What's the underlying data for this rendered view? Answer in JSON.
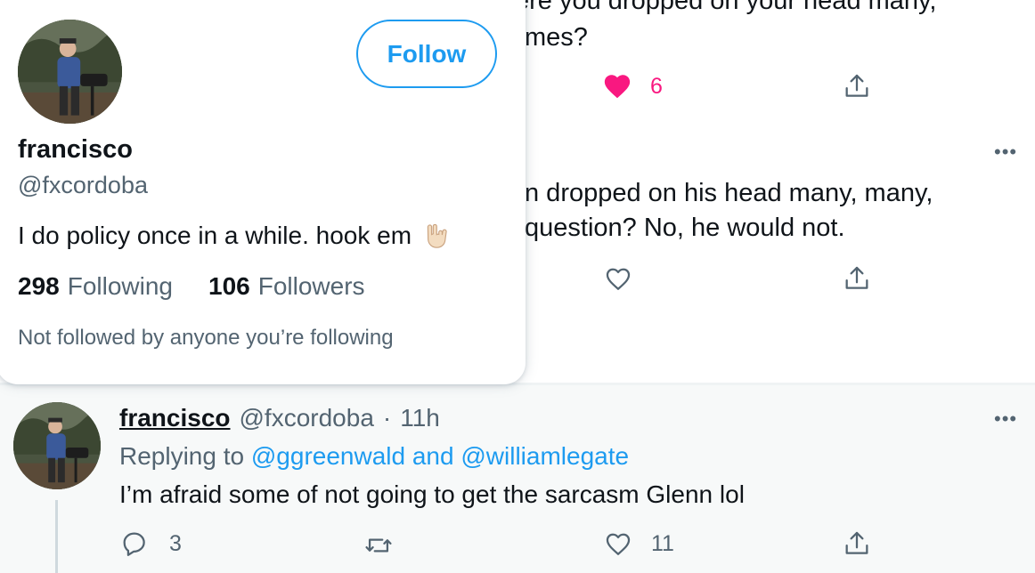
{
  "timeline": {
    "tweet1": {
      "text_line1": "ere you dropped on your head many,",
      "text_line2": "mes?",
      "like_count": "6"
    },
    "tweet2": {
      "text_line1": "n dropped on his head many, many,",
      "text_line2": "question? No, he would not."
    },
    "tweet3": {
      "display_name": "francisco",
      "handle": "@fxcordoba",
      "separator": "·",
      "time": "11h",
      "replying_prefix": "Replying to",
      "reply_user1": "@ggreenwald",
      "reply_and": "and",
      "reply_user2": "@williamlegate",
      "text": "I’m afraid some of not going to get the sarcasm Glenn lol",
      "reply_count": "3",
      "like_count": "11"
    }
  },
  "hover_card": {
    "follow_label": "Follow",
    "display_name": "francisco",
    "handle": "@fxcordoba",
    "bio": "I do policy once in a while. hook em",
    "following_count": "298",
    "following_label": "Following",
    "followers_count": "106",
    "followers_label": "Followers",
    "note": "Not followed by anyone you’re following"
  },
  "icons": {
    "more": "more-icon",
    "heart": "heart-icon",
    "share": "share-icon",
    "reply": "reply-icon",
    "retweet": "retweet-icon",
    "rock_hand": "rock-hand-emoji"
  },
  "colors": {
    "accent": "#1d9bf0",
    "like_active": "#f91880",
    "secondary_text": "#536471"
  }
}
